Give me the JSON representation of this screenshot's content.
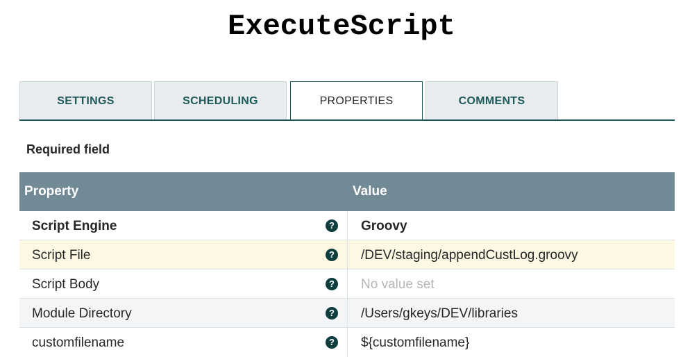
{
  "title": "ExecuteScript",
  "tabs": [
    {
      "label": "SETTINGS"
    },
    {
      "label": "SCHEDULING"
    },
    {
      "label": "PROPERTIES"
    },
    {
      "label": "COMMENTS"
    }
  ],
  "required_label": "Required field",
  "table": {
    "headers": [
      "Property",
      "Value"
    ],
    "rows": [
      {
        "name": "Script Engine",
        "value": "Groovy"
      },
      {
        "name": "Script File",
        "value": "/DEV/staging/appendCustLog.groovy"
      },
      {
        "name": "Script Body",
        "value": "No value set"
      },
      {
        "name": "Module Directory",
        "value": "/Users/gkeys/DEV/libraries"
      },
      {
        "name": "customfilename",
        "value": "${customfilename}"
      }
    ]
  },
  "help_glyph": "?",
  "colors": {
    "header": "#728a96",
    "accent": "#1d5a5a",
    "highlight": "#fdf8e4"
  }
}
